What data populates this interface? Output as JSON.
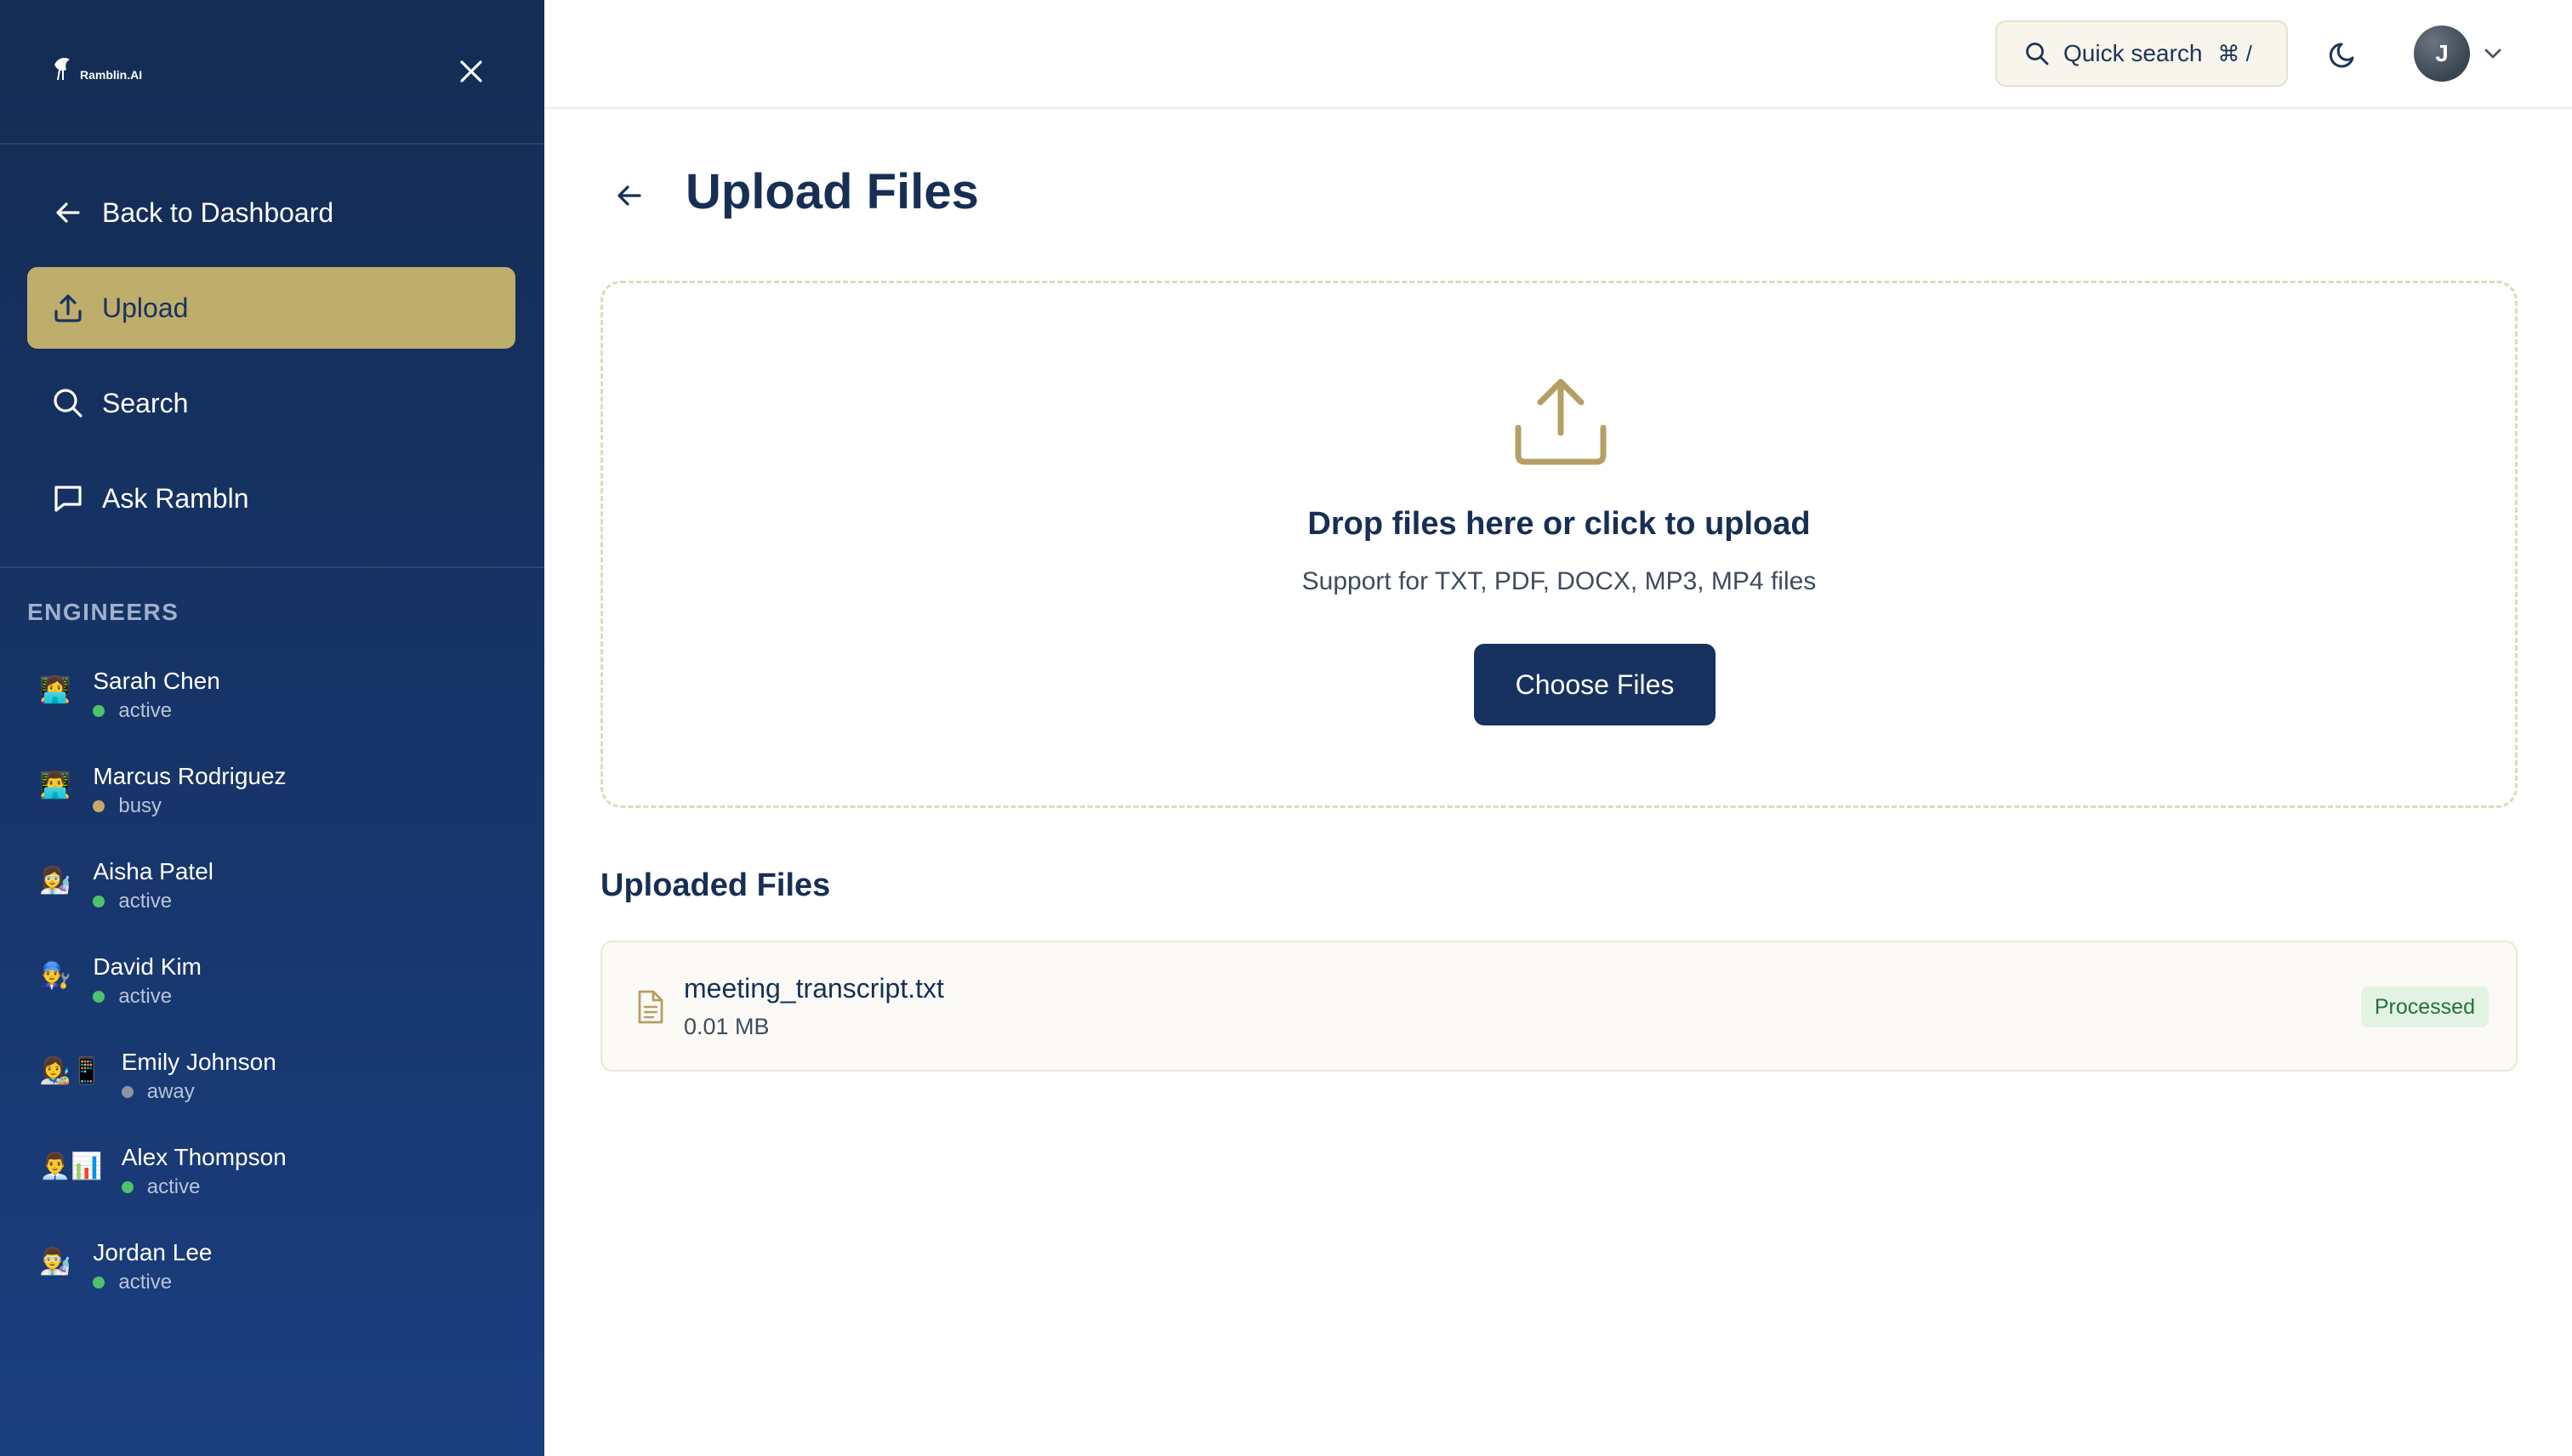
{
  "brand": {
    "name": "Ramblin.AI"
  },
  "sidebar": {
    "nav": [
      {
        "label": "Back to Dashboard",
        "icon": "arrow-left-icon"
      },
      {
        "label": "Upload",
        "icon": "upload-icon",
        "active": true
      },
      {
        "label": "Search",
        "icon": "search-icon"
      },
      {
        "label": "Ask Rambln",
        "icon": "chat-icon"
      }
    ],
    "section_label": "ENGINEERS",
    "engineers": [
      {
        "name": "Sarah Chen",
        "status": "active",
        "avatar": "👩‍💻"
      },
      {
        "name": "Marcus Rodriguez",
        "status": "busy",
        "avatar": "👨‍💻"
      },
      {
        "name": "Aisha Patel",
        "status": "active",
        "avatar": "👩‍🔬"
      },
      {
        "name": "David Kim",
        "status": "active",
        "avatar": "👨‍🔧"
      },
      {
        "name": "Emily Johnson",
        "status": "away",
        "avatar": "👩‍🎨📱"
      },
      {
        "name": "Alex Thompson",
        "status": "active",
        "avatar": "👨‍💼📊"
      },
      {
        "name": "Jordan Lee",
        "status": "active",
        "avatar": "👨‍🔬"
      }
    ]
  },
  "header": {
    "quick_search": {
      "label": "Quick search",
      "shortcut": "⌘ /"
    },
    "user_initial": "J"
  },
  "main": {
    "title": "Upload Files",
    "dropzone": {
      "title": "Drop files here or click to upload",
      "subtitle": "Support for TXT, PDF, DOCX, MP3, MP4 files",
      "button": "Choose Files"
    },
    "uploaded_title": "Uploaded Files",
    "files": [
      {
        "name": "meeting_transcript.txt",
        "size": "0.01 MB",
        "status": "Processed"
      }
    ]
  },
  "colors": {
    "sidebar_bg": "#17356a",
    "accent_gold": "#bfad6c",
    "primary_navy": "#17325e",
    "status_active": "#4cc36b",
    "status_busy": "#c9a86b",
    "status_away": "#8b93a3"
  }
}
